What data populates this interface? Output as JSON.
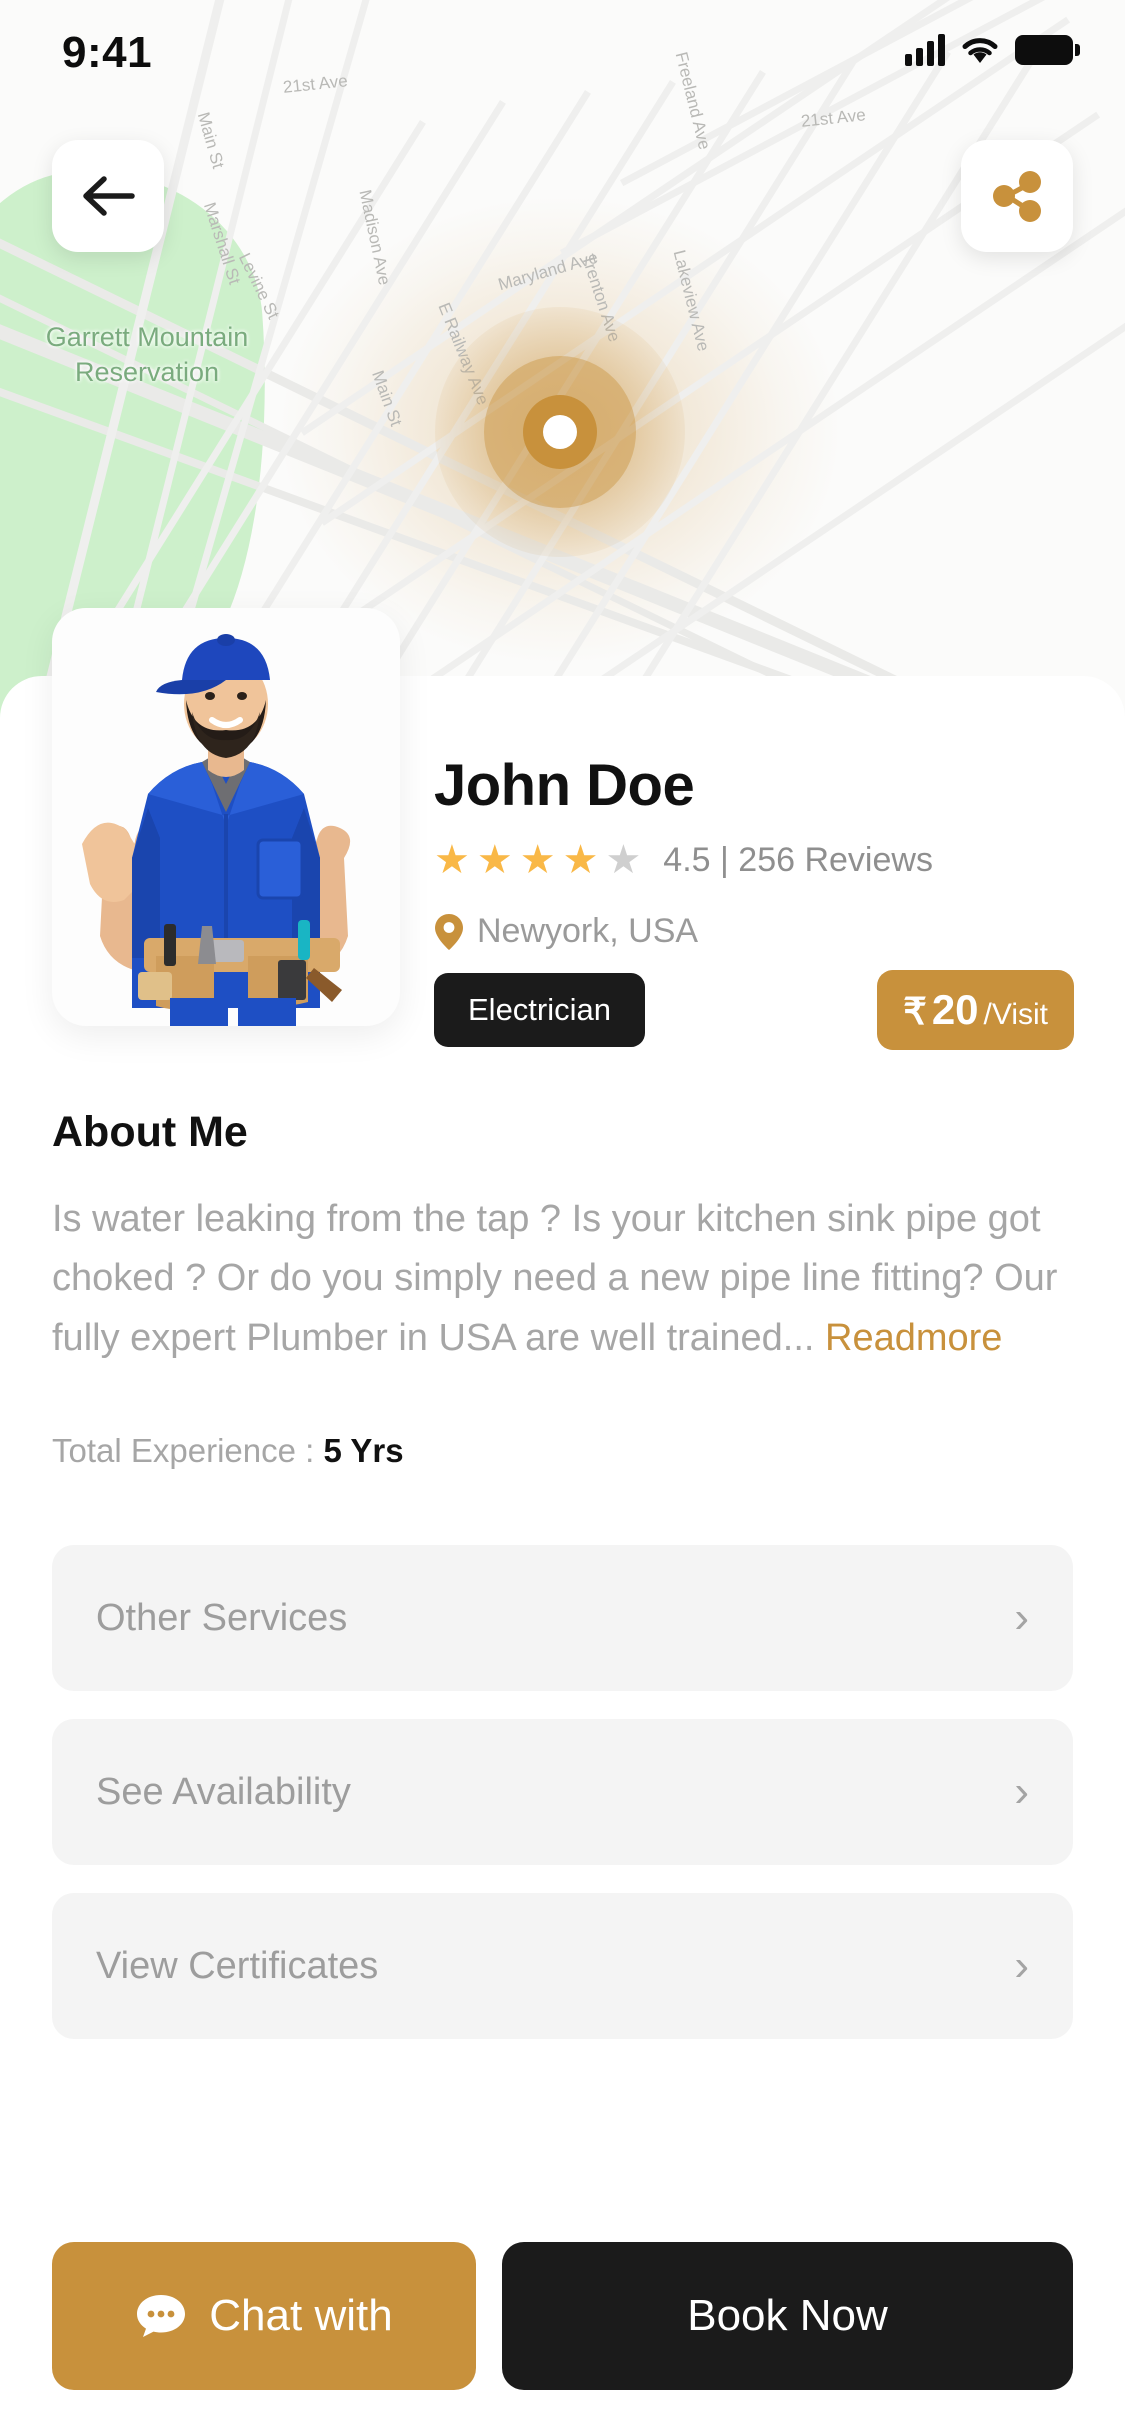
{
  "status_bar": {
    "time": "9:41",
    "cellular_icon": "signal-bars-icon",
    "wifi_icon": "wifi-icon",
    "battery_icon": "battery-full-icon"
  },
  "map": {
    "back_icon": "arrow-left-icon",
    "share_icon": "share-icon",
    "marker_icon": "location-marker-icon",
    "park_label": "Garrett Mountain Reservation",
    "street_labels": [
      "21st Ave",
      "21st Ave",
      "Main St",
      "Marshall St",
      "Levine St",
      "Madison Ave",
      "Maryland Ave",
      "Trenton Ave",
      "Lakeview Ave",
      "E Railway Ave",
      "Main St",
      "Freeland Ave"
    ]
  },
  "profile": {
    "photo_alt": "electrician-portrait",
    "name": "John Doe",
    "rating_value": 4.5,
    "stars_filled": 4,
    "stars_total": 5,
    "rating_text": "4.5 | 256 Reviews",
    "reviews_count": 256,
    "location_icon": "map-pin-icon",
    "location": "Newyork, USA",
    "tag": "Electrician",
    "price": {
      "currency": "₹",
      "amount": "20",
      "unit": "/Visit"
    }
  },
  "about": {
    "title": "About Me",
    "text": "Is water leaking from the tap ? Is your kitchen sink pipe got choked ? Or do you simply need a new pipe line fitting? Our fully expert Plumber in USA are well trained... ",
    "read_more": "Readmore",
    "experience_label": "Total Experience : ",
    "experience_value": "5 Yrs"
  },
  "menu_rows": [
    {
      "label": "Other Services",
      "chevron": "chevron-right-icon"
    },
    {
      "label": "See Availability",
      "chevron": "chevron-right-icon"
    },
    {
      "label": "View Certificates",
      "chevron": "chevron-right-icon"
    }
  ],
  "actions": {
    "chat_label": "Chat with",
    "chat_icon": "chat-bubble-icon",
    "book_label": "Book Now"
  },
  "colors": {
    "accent_gold": "#c8913c",
    "dark": "#1b1b1b",
    "star_gold": "#f9b847",
    "star_grey": "#cfcfcf",
    "muted_text": "#a6a6a6",
    "row_bg": "#f4f4f4",
    "park_green": "#cdf0cb"
  }
}
